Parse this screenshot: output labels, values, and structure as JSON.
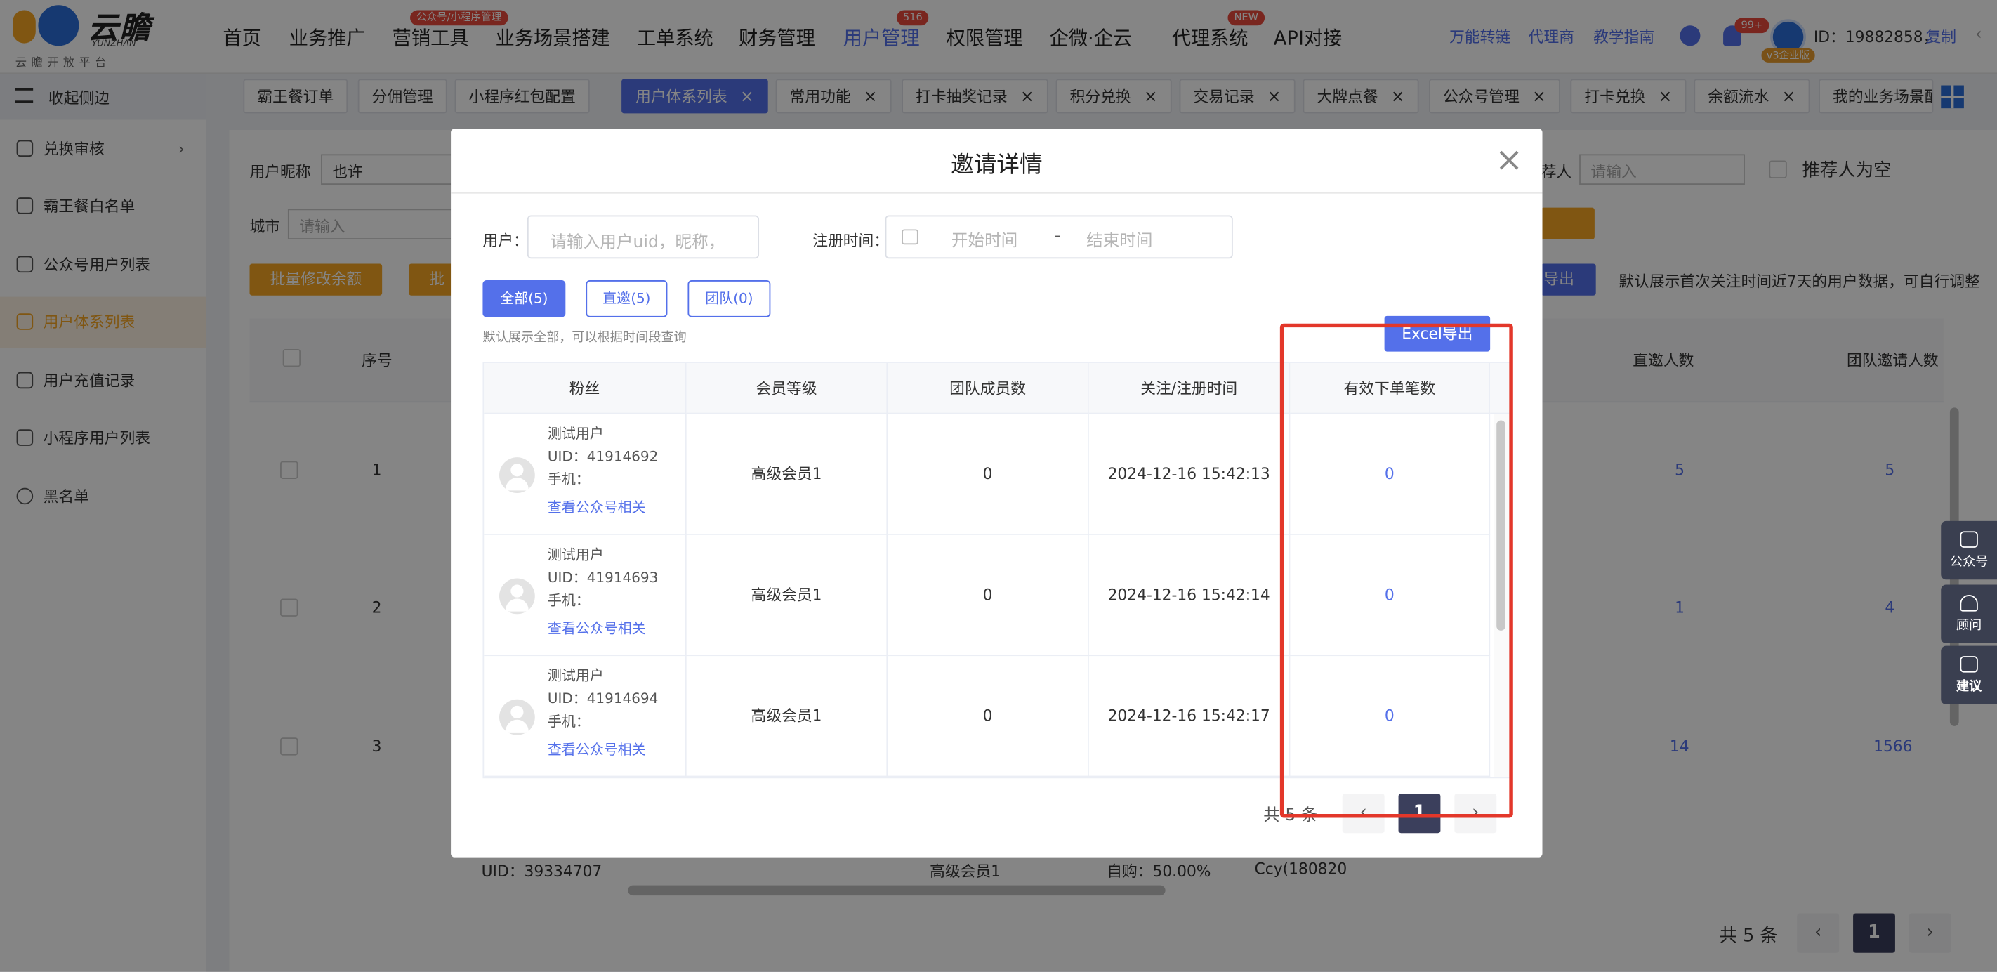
{
  "header": {
    "logo": {
      "name": "云瞻",
      "en": "YUNZHAN",
      "sub": "云瞻开放平台"
    },
    "nav": [
      {
        "label": "首页"
      },
      {
        "label": "业务推广"
      },
      {
        "label": "营销工具",
        "badge": "公众号/小程序管理"
      },
      {
        "label": "业务场景搭建"
      },
      {
        "label": "工单系统"
      },
      {
        "label": "财务管理"
      },
      {
        "label": "用户管理",
        "badge": "516",
        "active": true
      },
      {
        "label": "权限管理"
      },
      {
        "label": "企微·企云"
      },
      {
        "label": "代理系统",
        "badge": "NEW"
      },
      {
        "label": "API对接"
      }
    ],
    "links": [
      "万能转链",
      "代理商",
      "教学指南"
    ],
    "notification_count": "99+",
    "vip_label": "v3企业版",
    "user_id_label": "ID：19882858，",
    "copy_label": "复制"
  },
  "sidebar": {
    "collapse_label": "收起侧边",
    "items": [
      {
        "label": "兑换审核",
        "icon": "user-icon",
        "has_arrow": true
      },
      {
        "label": "霸王餐白名单",
        "icon": "user-icon"
      },
      {
        "label": "公众号用户列表",
        "icon": "wechat-icon"
      },
      {
        "label": "用户体系列表",
        "icon": "user-icon",
        "active": true
      },
      {
        "label": "用户充值记录",
        "icon": "document-icon"
      },
      {
        "label": "小程序用户列表",
        "icon": "user-group-icon"
      },
      {
        "label": "黑名单",
        "icon": "block-icon"
      }
    ]
  },
  "tabs": [
    {
      "label": "霸王餐订单"
    },
    {
      "label": "分佣管理"
    },
    {
      "label": "小程序红包配置"
    },
    {
      "label": "用户体系列表",
      "active": true,
      "closable": true
    },
    {
      "label": "常用功能",
      "closable": true
    },
    {
      "label": "打卡抽奖记录",
      "closable": true
    },
    {
      "label": "积分兑换",
      "closable": true
    },
    {
      "label": "交易记录",
      "closable": true
    },
    {
      "label": "大牌点餐",
      "closable": true
    },
    {
      "label": "公众号管理",
      "closable": true
    },
    {
      "label": "打卡兑换",
      "closable": true
    },
    {
      "label": "余额流水",
      "closable": true
    },
    {
      "label": "我的业务场景配"
    }
  ],
  "background": {
    "filter_nickname_label": "用户昵称",
    "filter_nickname_value": "也许",
    "filter_city_label": "城市",
    "filter_city_placeholder": "请输入",
    "referrer_label": "荐人",
    "referrer_placeholder": "请输入",
    "referrer_empty_label": "推荐人为空",
    "batch_balance_button": "批量修改余额",
    "batch_button_partial": "批",
    "export_partial": "导出",
    "default_notice": "默认展示首次关注时间近7天的用户数据，可自行调整",
    "columns": {
      "index": "序号",
      "direct_invites": "直邀人数",
      "team_invites": "团队邀请人数"
    },
    "rows": [
      {
        "index": "1",
        "direct": "5",
        "team": "5"
      },
      {
        "index": "2",
        "direct": "1",
        "team": "4"
      },
      {
        "index": "3",
        "direct": "14",
        "team": "1566"
      }
    ],
    "partial_row": {
      "uid": "UID：39334707",
      "level": "高级会员1",
      "self_buy": "自购：50.00%",
      "referrer": "Ccy(180820"
    },
    "pagination": {
      "total": "共 5 条",
      "current": "1"
    }
  },
  "modal": {
    "title": "邀请详情",
    "user_label": "用户：",
    "user_placeholder": "请输入用户uid，昵称，",
    "reg_time_label": "注册时间：",
    "start_placeholder": "开始时间",
    "separator": "-",
    "end_placeholder": "结束时间",
    "segments": [
      {
        "label": "全部(5)",
        "active": true
      },
      {
        "label": "直邀(5)"
      },
      {
        "label": "团队(0)"
      }
    ],
    "hint": "默认展示全部，可以根据时间段查询",
    "export_button": "Excel导出",
    "columns": [
      "粉丝",
      "会员等级",
      "团队成员数",
      "关注/注册时间",
      "有效下单笔数"
    ],
    "rows": [
      {
        "name": "测试用户",
        "uid": "UID：41914692",
        "phone": "手机：",
        "link": "查看公众号相关",
        "level": "高级会员1",
        "team": "0",
        "time": "2024-12-16 15:42:13",
        "orders": "0"
      },
      {
        "name": "测试用户",
        "uid": "UID：41914693",
        "phone": "手机：",
        "link": "查看公众号相关",
        "level": "高级会员1",
        "team": "0",
        "time": "2024-12-16 15:42:14",
        "orders": "0"
      },
      {
        "name": "测试用户",
        "uid": "UID：41914694",
        "phone": "手机：",
        "link": "查看公众号相关",
        "level": "高级会员1",
        "team": "0",
        "time": "2024-12-16 15:42:17",
        "orders": "0"
      }
    ],
    "pagination": {
      "total": "共 5 条",
      "prev": "‹",
      "current": "1",
      "next": "›"
    }
  },
  "float_buttons": [
    {
      "label": "公众号",
      "icon": "chat-icon"
    },
    {
      "label": "顾问",
      "icon": "headset-icon"
    },
    {
      "label": "建议",
      "icon": "edit-icon"
    }
  ],
  "colors": {
    "accent": "#5470ea",
    "orange": "#f5a623",
    "highlight": "#e3372a"
  }
}
